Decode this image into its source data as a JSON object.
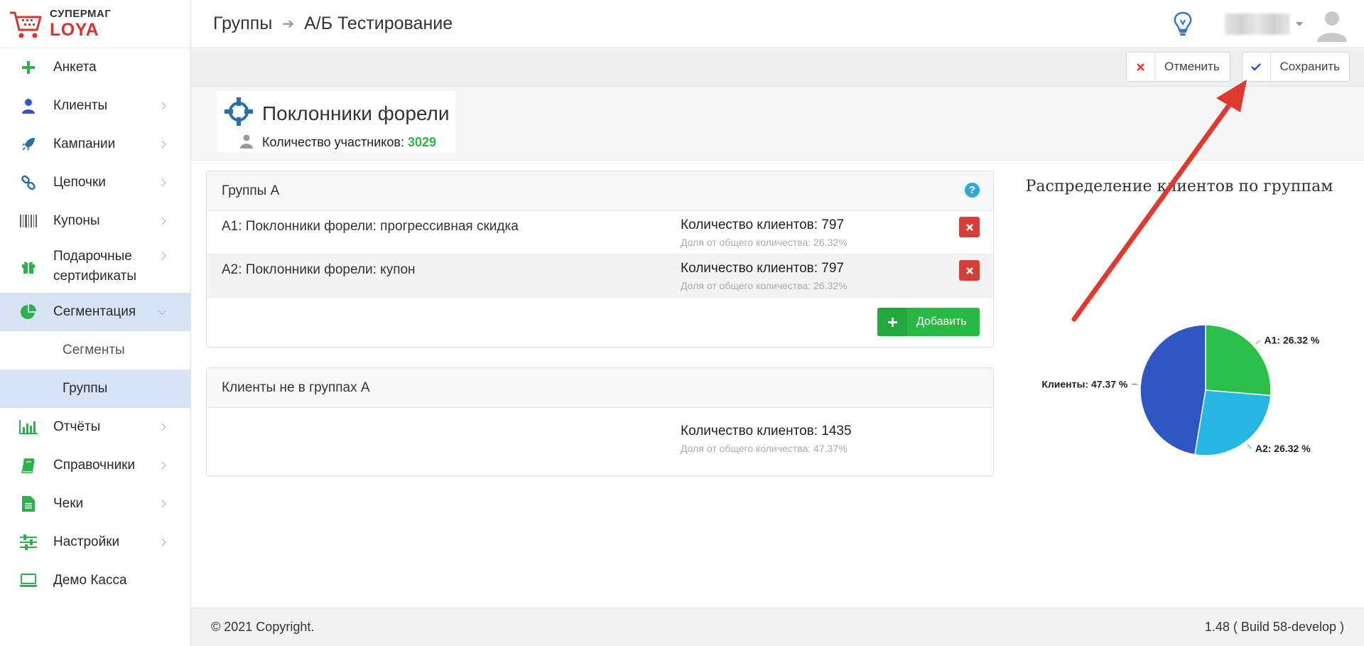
{
  "brand": {
    "sub": "СУПЕРМАГ",
    "name": "LOYA"
  },
  "sidebar": {
    "items": [
      {
        "label": "Анкета",
        "icon": "plus-icon"
      },
      {
        "label": "Клиенты",
        "icon": "user-icon"
      },
      {
        "label": "Кампании",
        "icon": "rocket-icon"
      },
      {
        "label": "Цепочки",
        "icon": "link-icon"
      },
      {
        "label": "Купоны",
        "icon": "barcode-icon"
      },
      {
        "label": "Подарочные сертификаты",
        "icon": "gift-icon"
      },
      {
        "label": "Сегментация",
        "icon": "pie-chart-icon"
      },
      {
        "label": "Отчёты",
        "icon": "bar-chart-icon"
      },
      {
        "label": "Справочники",
        "icon": "book-icon"
      },
      {
        "label": "Чеки",
        "icon": "receipt-icon"
      },
      {
        "label": "Настройки",
        "icon": "sliders-icon"
      },
      {
        "label": "Демо Касса",
        "icon": "laptop-icon"
      }
    ],
    "sub": [
      {
        "label": "Сегменты"
      },
      {
        "label": "Группы"
      }
    ]
  },
  "breadcrumb": {
    "parent": "Группы",
    "current": "А/Б Тестирование"
  },
  "actions": {
    "cancel": "Отменить",
    "save": "Сохранить"
  },
  "group": {
    "title": "Поклонники форели",
    "count_label": "Количество участников:",
    "count_value": "3029"
  },
  "groups_panel": {
    "title": "Группы А",
    "help": "?",
    "rows": [
      {
        "name": "А1: Поклонники форели: прогрессивная скидка",
        "count": "Количество клиентов: 797",
        "share": "Доля от общего количества: 26.32%"
      },
      {
        "name": "А2: Поклонники форели: купон",
        "count": "Количество клиентов: 797",
        "share": "Доля от общего количества: 26.32%"
      }
    ],
    "add_label": "Добавить"
  },
  "nogroup_panel": {
    "title": "Клиенты не в группах А",
    "count": "Количество клиентов: 1435",
    "share": "Доля от общего количества: 47.37%"
  },
  "chart_data": {
    "type": "pie",
    "title": "Распределение клиентов по группам",
    "slices": [
      {
        "label": "А1",
        "value": 26.32,
        "color": "#2bbf4a",
        "text": "А1: 26.32 %"
      },
      {
        "label": "А2",
        "value": 26.32,
        "color": "#26b6e4",
        "text": "А2: 26.32 %"
      },
      {
        "label": "Клиенты",
        "value": 47.37,
        "color": "#2f56c4",
        "text": "Клиенты: 47.37 %"
      }
    ]
  },
  "footer": {
    "copyright": "© 2021 Copyright.",
    "version": "1.48 ( Build 58-develop )"
  }
}
